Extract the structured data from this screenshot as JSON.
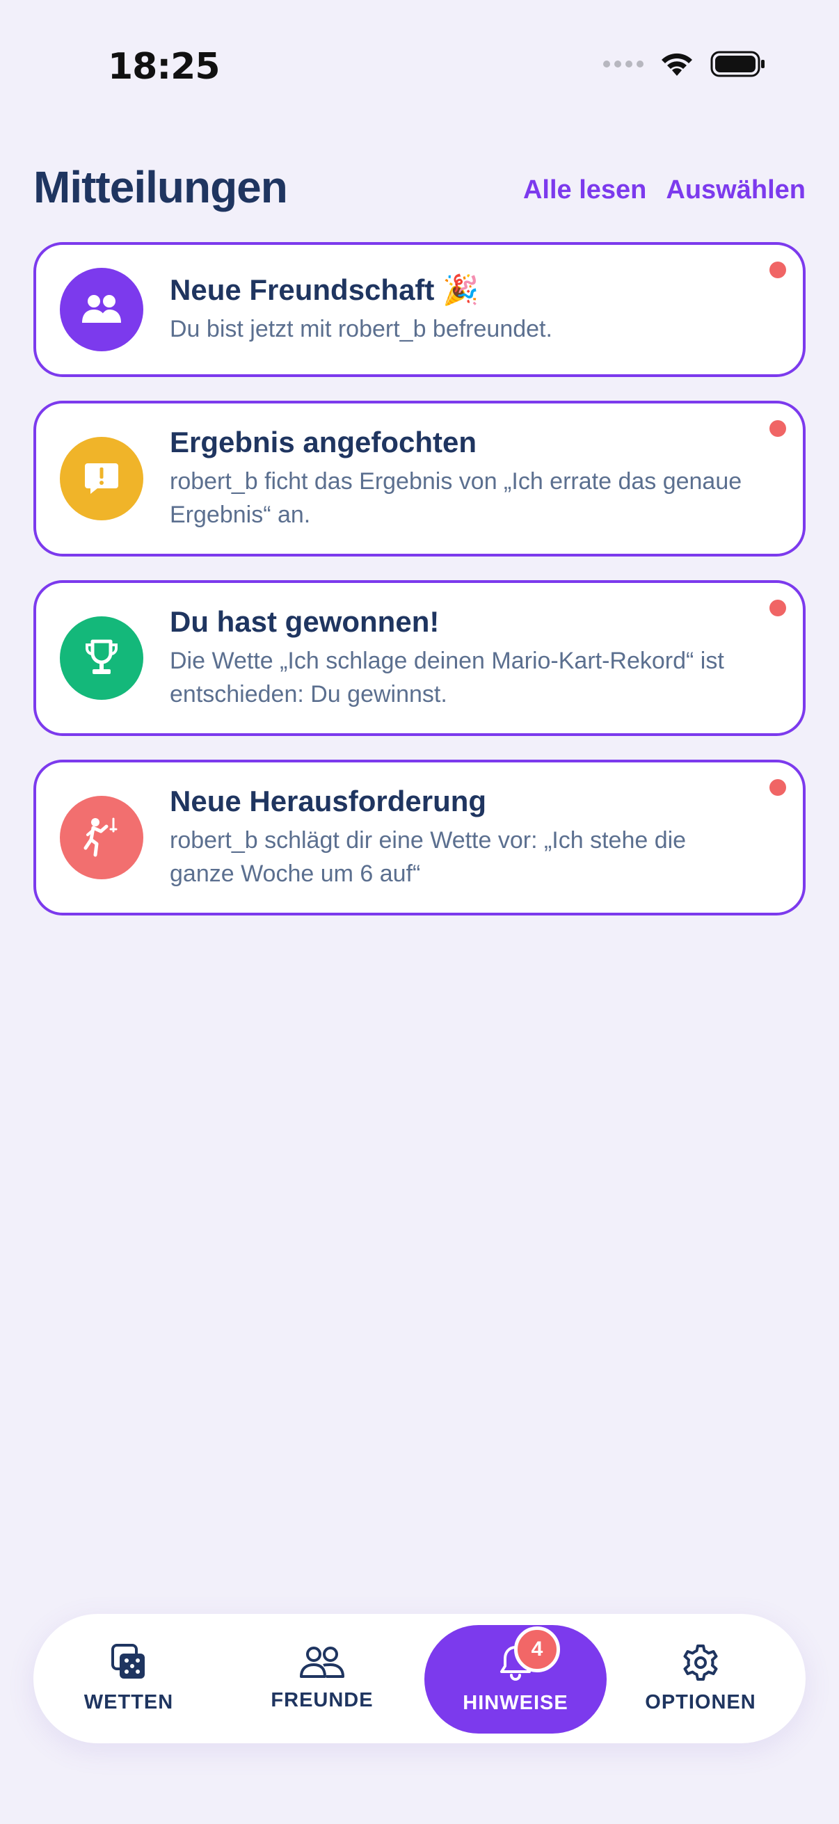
{
  "status_bar": {
    "time": "18:25"
  },
  "header": {
    "title": "Mitteilungen",
    "read_all": "Alle lesen",
    "select": "Auswählen"
  },
  "notifications": [
    {
      "title": "Neue Freundschaft 🎉",
      "body": "Du bist jetzt mit robert_b befreundet.",
      "icon": "friends-icon",
      "color": "#7c3aed",
      "unread": true
    },
    {
      "title": "Ergebnis angefochten",
      "body": "robert_b ficht das Ergebnis von „Ich errate das genaue Ergebnis“ an.",
      "icon": "alert-message-icon",
      "color": "#f0b429",
      "unread": true
    },
    {
      "title": "Du hast gewonnen!",
      "body": "Die Wette „Ich schlage deinen Mario-Kart-Rekord“ ist entschieden: Du gewinnst.",
      "icon": "trophy-icon",
      "color": "#14b87a",
      "unread": true
    },
    {
      "title": "Neue Herausforderung",
      "body": "robert_b schlägt dir eine Wette vor: „Ich stehe die ganze Woche um 6 auf“",
      "icon": "fencing-icon",
      "color": "#f26f6f",
      "unread": true
    }
  ],
  "tabbar": {
    "tabs": [
      {
        "label": "WETTEN",
        "icon": "dice-icon"
      },
      {
        "label": "FREUNDE",
        "icon": "friends-outline-icon"
      },
      {
        "label": "HINWEISE",
        "icon": "bell-icon",
        "active": true,
        "badge": "4"
      },
      {
        "label": "OPTIONEN",
        "icon": "gear-icon"
      }
    ]
  },
  "colors": {
    "accent": "#7c3aed",
    "background": "#f2f0fa",
    "unread": "#f06565"
  }
}
